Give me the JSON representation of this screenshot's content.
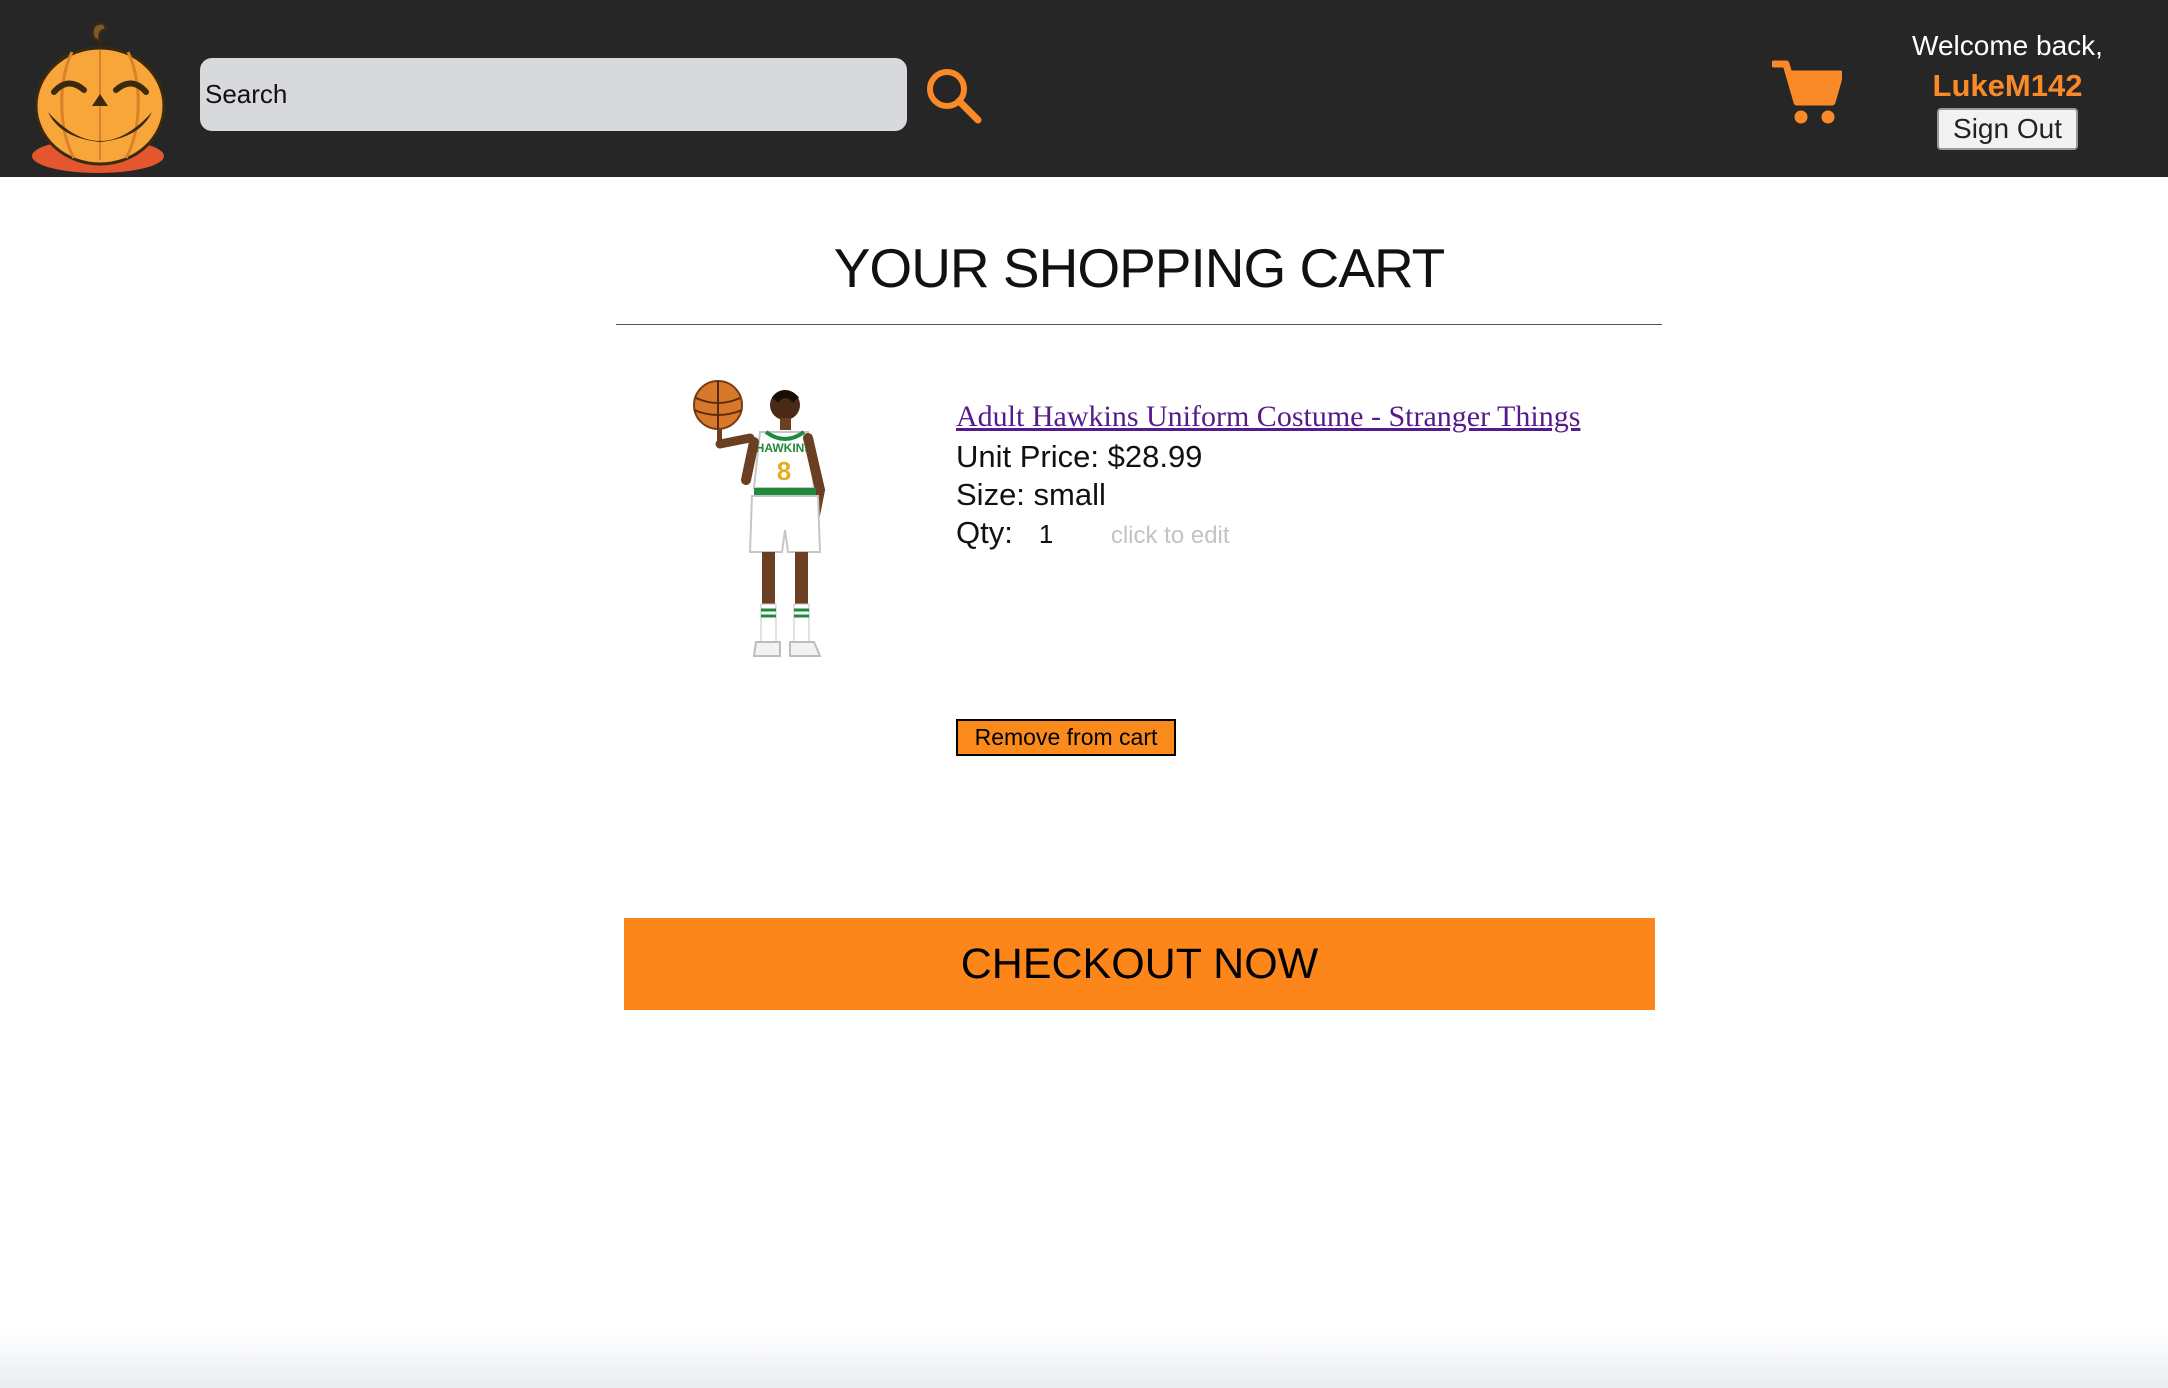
{
  "header": {
    "search": {
      "placeholder": "Search",
      "value": ""
    },
    "icons": {
      "logo": "pumpkin-logo-icon",
      "search": "search-icon",
      "cart": "cart-icon"
    },
    "user": {
      "welcome": "Welcome back,",
      "username": "LukeM142",
      "signout_label": "Sign Out"
    }
  },
  "main": {
    "title": "YOUR SHOPPING CART",
    "items": [
      {
        "name": "Adult Hawkins Uniform Costume - Stranger Things",
        "unit_price_label": "Unit Price:",
        "unit_price": "$28.99",
        "size_label": "Size:",
        "size": "small",
        "qty_label": "Qty:",
        "qty": "1",
        "qty_hint": "click to edit",
        "remove_label": "Remove from cart"
      }
    ],
    "checkout_label": "CHECKOUT NOW"
  },
  "colors": {
    "header_bg": "#262626",
    "accent": "#fd861a",
    "link": "#551a8b",
    "search_bg": "#d8d9dd"
  }
}
